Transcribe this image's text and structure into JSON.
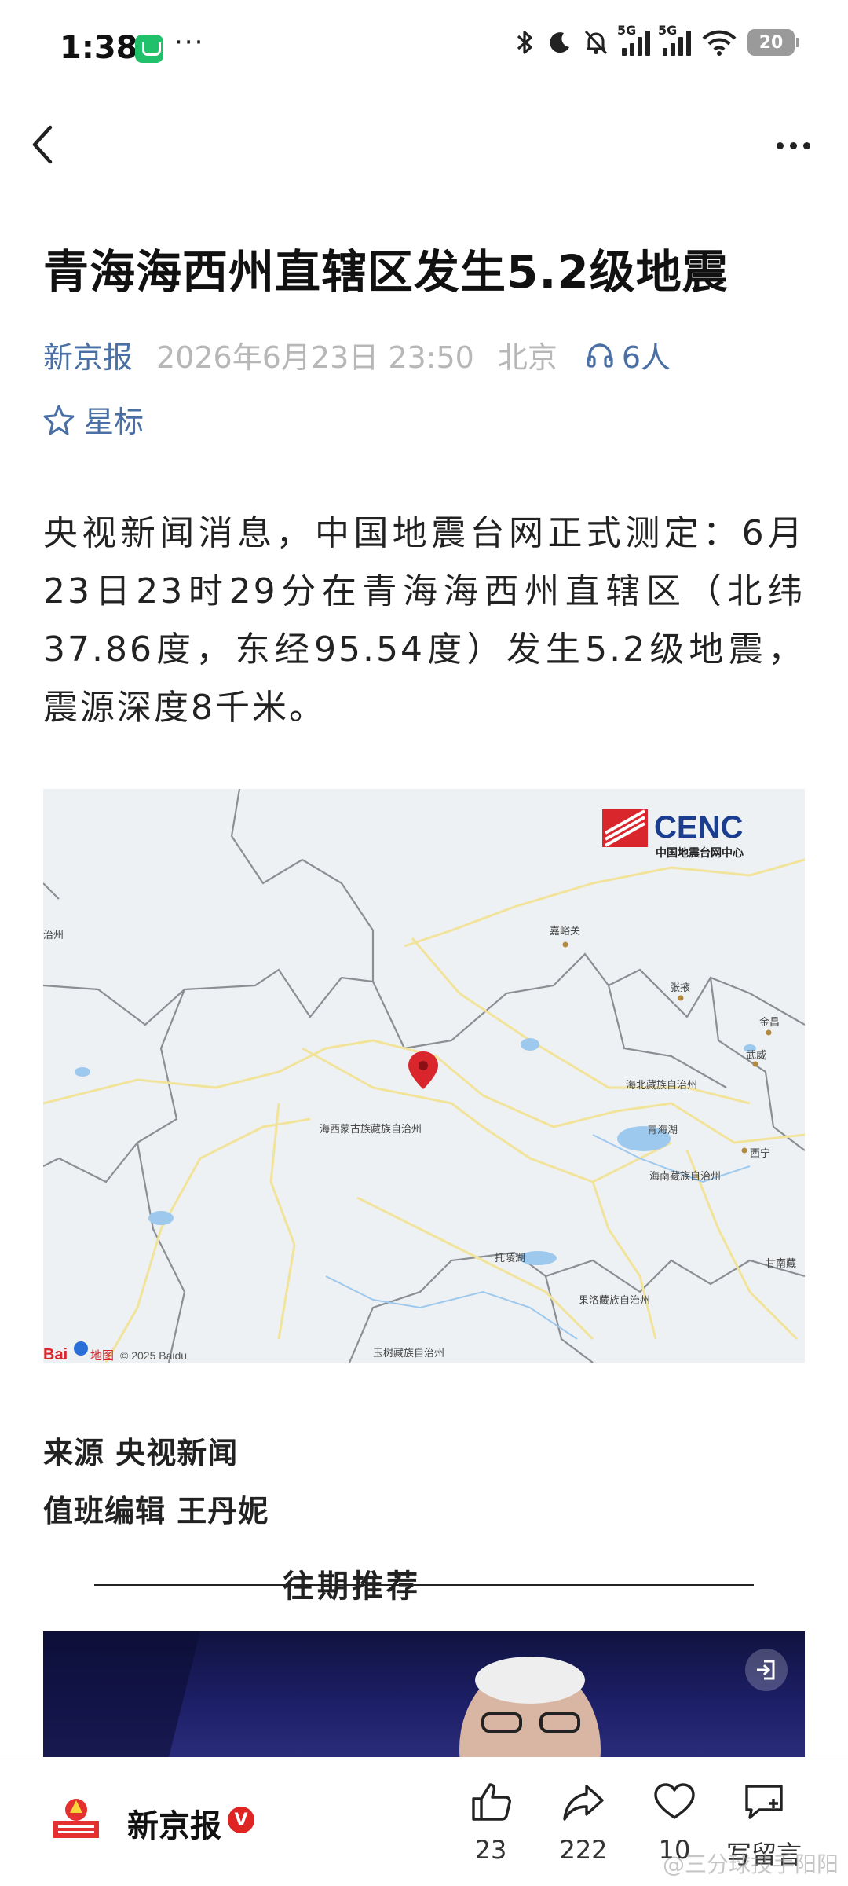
{
  "status_bar": {
    "time": "1:38",
    "dots": "···",
    "network_label_1": "5G",
    "network_label_2": "5G",
    "wifi_level": "6",
    "battery": "20"
  },
  "article": {
    "title": "青海海西州直辖区发生5.2级地震",
    "source": "新京报",
    "datetime": "2026年6月23日 23:50",
    "location": "北京",
    "listeners": "6人",
    "star_label": "星标",
    "body": "央视新闻消息，中国地震台网正式测定：6月23日23时29分在青海海西州直辖区（北纬37.86度，东经95.54度）发生5.2级地震，震源深度8千米。",
    "source_line": "来源 央视新闻",
    "editor_line": "值班编辑 王丹妮"
  },
  "map": {
    "logo_text": "CENC",
    "logo_subtitle": "中国地震台网中心",
    "labels": {
      "jiayuguan": "嘉峪关",
      "zhangye": "张掖",
      "jinchang": "金昌",
      "wuwei": "武威",
      "haibei": "海北藏族自治州",
      "qinghaihu": "青海湖",
      "xining": "西宁",
      "haixi": "海西蒙古族藏族自治州",
      "hainan": "海南藏族自治州",
      "tuosu": "托陵湖",
      "gannan": "甘南藏",
      "guoluo": "果洛藏族自治州",
      "yushu": "玉树藏族自治州",
      "side_left": "治州"
    },
    "credit_brand": "Bai",
    "credit_map": "地图",
    "credit_copyright": "© 2025 Baidu"
  },
  "recommend": {
    "title": "往期推荐"
  },
  "bottom_bar": {
    "brand_name": "新京报",
    "verified_mark": "V",
    "like_count": "23",
    "share_count": "222",
    "favorite_count": "10",
    "comment_label": "写留言",
    "watermark": "@三分球技手阳阳"
  },
  "colors": {
    "accent": "#4a6fa5",
    "muted": "#b7b7b7",
    "map_water": "#9ec9ee",
    "map_road": "#f2e39a",
    "marker": "#d9262c",
    "brand_red": "#e02424"
  },
  "icons": [
    "back-icon",
    "more-icon",
    "headphone-icon",
    "star-icon",
    "like-icon",
    "share-icon",
    "heart-icon",
    "comment-icon",
    "exit-icon",
    "location-pin-icon"
  ]
}
